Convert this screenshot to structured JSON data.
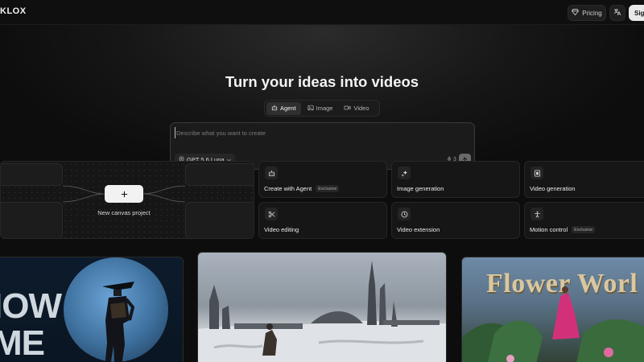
{
  "header": {
    "logo": "KLOX",
    "pricing_label": "Pricing",
    "signin_label": "Sig"
  },
  "hero": {
    "title": "Turn your ideas into videos",
    "tabs": [
      {
        "label": "Agent",
        "icon": "robot-icon",
        "active": true
      },
      {
        "label": "Image",
        "icon": "image-icon",
        "active": false
      },
      {
        "label": "Video",
        "icon": "video-icon",
        "active": false
      }
    ],
    "prompt": {
      "placeholder": "Describe what you want to create",
      "value": "",
      "model": "GPT 5.6 Luna",
      "credits": "3"
    }
  },
  "canvas": {
    "label": "New canvas project"
  },
  "actions": [
    {
      "label": "Create with Agent",
      "badge": "Exclusive",
      "icon": "robot-icon"
    },
    {
      "label": "Image generation",
      "badge": "",
      "icon": "sparkles-icon"
    },
    {
      "label": "Video generation",
      "badge": "",
      "icon": "film-icon"
    },
    {
      "label": "Video editing",
      "badge": "",
      "icon": "scissors-icon"
    },
    {
      "label": "Video extension",
      "badge": "",
      "icon": "clock-icon"
    },
    {
      "label": "Motion control",
      "badge": "Exclusive",
      "icon": "person-icon"
    }
  ],
  "showcase": {
    "left_text": "IOW\nME",
    "right_title": "Flower Worl"
  },
  "colors": {
    "background": "#0d0d0d",
    "card": "#161616",
    "accent_light": "#f2f2f2"
  }
}
